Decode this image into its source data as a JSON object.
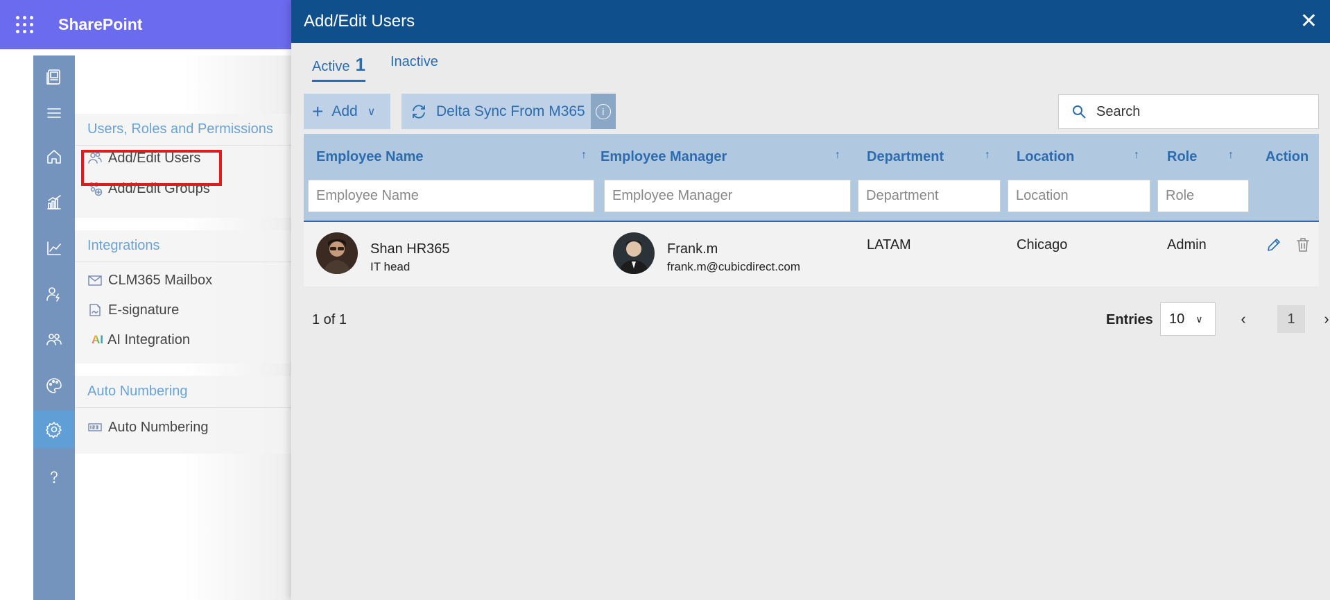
{
  "app": {
    "title": "SharePoint"
  },
  "menu": {
    "groups": [
      {
        "title": "Users, Roles and Permissions",
        "items": [
          {
            "label": "Add/Edit Users",
            "icon": "users-icon"
          },
          {
            "label": "Add/Edit Groups",
            "icon": "group-add-icon"
          }
        ]
      },
      {
        "title": "Integrations",
        "items": [
          {
            "label": "CLM365 Mailbox",
            "icon": "mail-icon"
          },
          {
            "label": "E-signature",
            "icon": "signature-icon"
          },
          {
            "label": "AI Integration",
            "icon": "ai-icon"
          }
        ]
      },
      {
        "title": "Auto Numbering",
        "items": [
          {
            "label": "Auto Numbering",
            "icon": "numbering-icon"
          }
        ]
      }
    ]
  },
  "panel": {
    "title": "Add/Edit Users",
    "tabs": [
      {
        "label": "Active",
        "count": "1"
      },
      {
        "label": "Inactive"
      }
    ],
    "toolbar": {
      "add_label": "Add",
      "sync_label": "Delta Sync From M365"
    },
    "search": {
      "placeholder": "Search"
    },
    "table": {
      "columns": [
        {
          "label": "Employee Name",
          "filter_placeholder": "Employee Name"
        },
        {
          "label": "Employee Manager",
          "filter_placeholder": "Employee Manager"
        },
        {
          "label": "Department",
          "filter_placeholder": "Department"
        },
        {
          "label": "Location",
          "filter_placeholder": "Location"
        },
        {
          "label": "Role",
          "filter_placeholder": "Role"
        },
        {
          "label": "Action"
        }
      ],
      "rows": [
        {
          "name": "Shan HR365",
          "title": "IT head",
          "manager_name": "Frank.m",
          "manager_email": "frank.m@cubicdirect.com",
          "department": "LATAM",
          "location": "Chicago",
          "role": "Admin"
        }
      ]
    },
    "footer": {
      "count_text": "1 of 1",
      "entries_label": "Entries",
      "entries_value": "10",
      "page": "1"
    }
  },
  "colors": {
    "topbar": "#6b6bf0",
    "panel_header": "#0e4f8c",
    "accent": "#2b6cb0",
    "rail": "#7494bd",
    "highlight": "#e01c1c"
  }
}
